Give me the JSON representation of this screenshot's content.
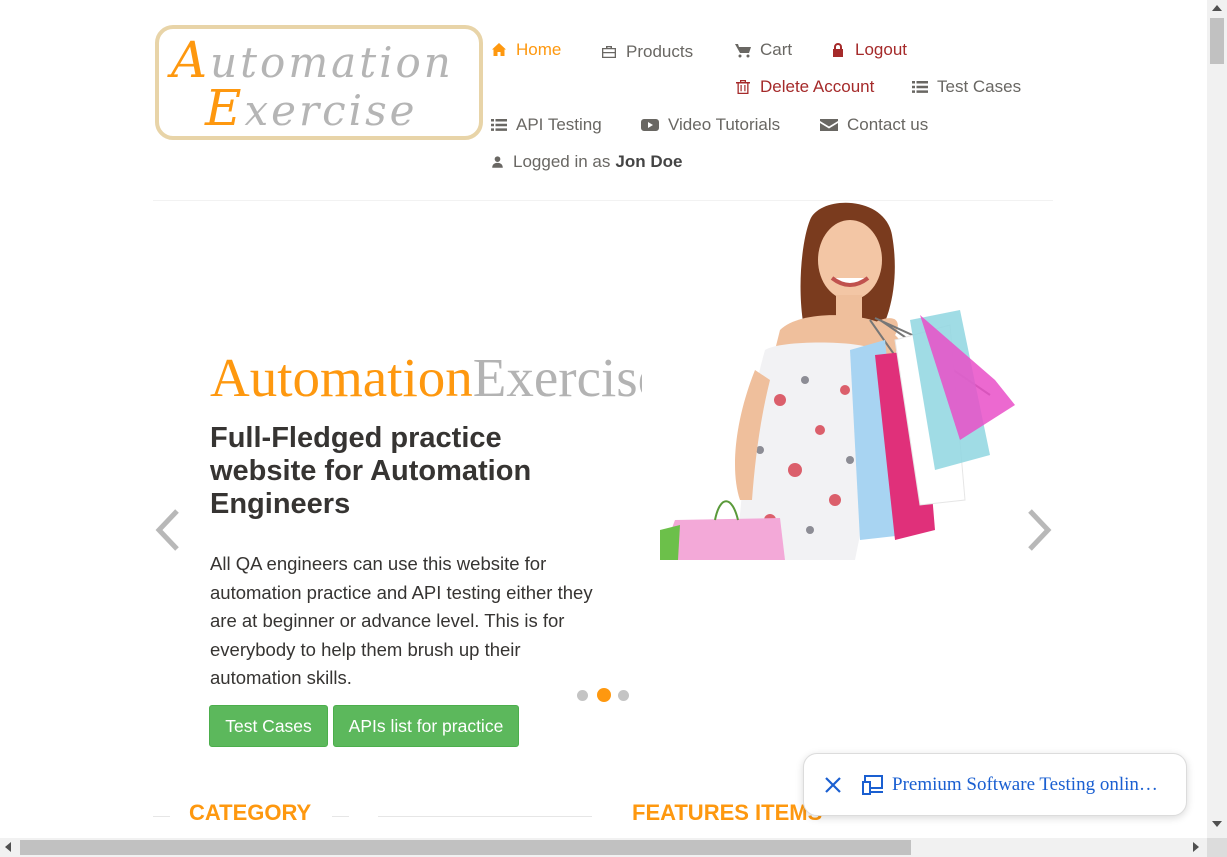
{
  "logo": {
    "line1_cap": "A",
    "line1_rest": "utomation",
    "line2_cap": "E",
    "line2_rest": "xercise"
  },
  "nav": {
    "home": "Home",
    "products": "Products",
    "cart": "Cart",
    "logout": "Logout",
    "delete_account": "Delete Account",
    "test_cases": "Test Cases",
    "api_testing": "API Testing",
    "video_tutorials": "Video Tutorials",
    "contact_us": "Contact us",
    "logged_in_prefix": "Logged in as",
    "username": "Jon Doe"
  },
  "slider": {
    "brand_part1": "Automation",
    "brand_part2": "Exercise",
    "headline": "Full-Fledged practice website for Automation Engineers",
    "description": "All QA engineers can use this website for automation practice and API testing either they are at beginner or advance level. This is for everybody to help them brush up their automation skills.",
    "button_test_cases": "Test Cases",
    "button_apis": "APIs list for practice",
    "active_slide": 2,
    "slide_count": 3
  },
  "sections": {
    "category": "CATEGORY",
    "features": "FEATURES ITEMS"
  },
  "popup": {
    "text": "Premium Software Testing online courses"
  },
  "colors": {
    "accent": "#fe980f",
    "danger": "#a52a2a",
    "button": "#5cb85c",
    "link": "#1a5fd1"
  }
}
